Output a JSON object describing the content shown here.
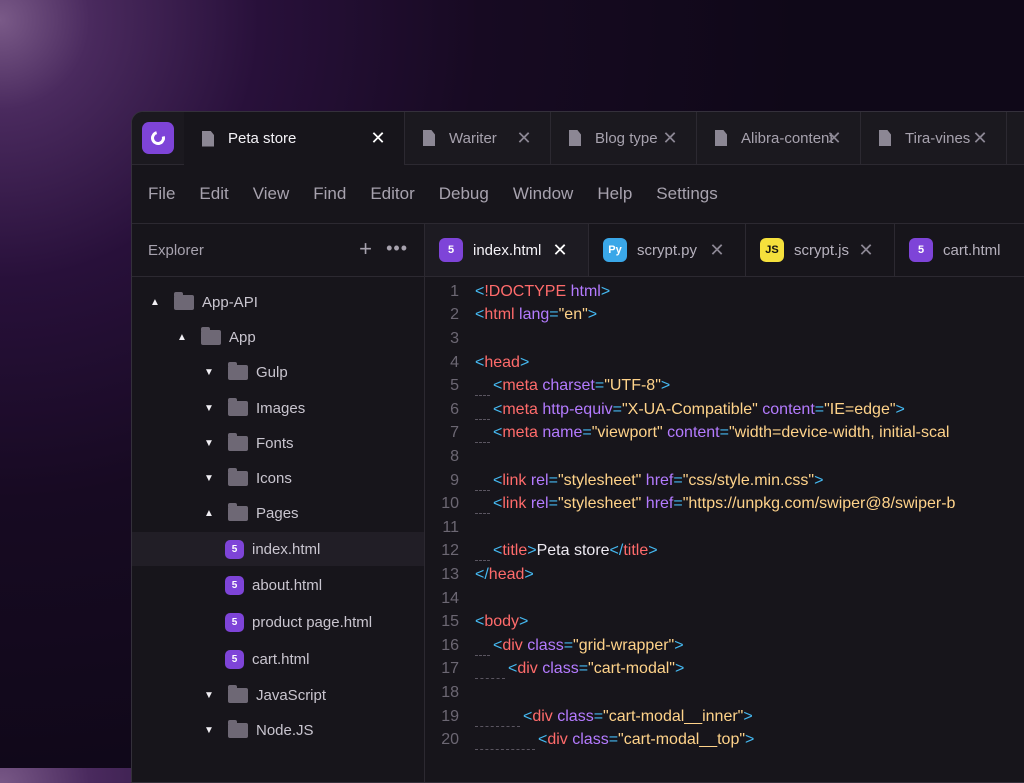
{
  "file_tabs": [
    {
      "label": "Peta store",
      "active": true
    },
    {
      "label": "Wariter",
      "active": false
    },
    {
      "label": "Blog type",
      "active": false
    },
    {
      "label": "Alibra-content",
      "active": false
    },
    {
      "label": "Tira-vines",
      "active": false
    }
  ],
  "menu": [
    "File",
    "Edit",
    "View",
    "Find",
    "Editor",
    "Debug",
    "Window",
    "Help",
    "Settings"
  ],
  "explorer": {
    "title": "Explorer",
    "tree": [
      {
        "label": "App-API",
        "type": "folder",
        "expanded": true,
        "depth": 0
      },
      {
        "label": "App",
        "type": "folder",
        "expanded": true,
        "depth": 1
      },
      {
        "label": "Gulp",
        "type": "folder",
        "expanded": false,
        "depth": 2
      },
      {
        "label": "Images",
        "type": "folder",
        "expanded": false,
        "depth": 2
      },
      {
        "label": "Fonts",
        "type": "folder",
        "expanded": false,
        "depth": 2
      },
      {
        "label": "Icons",
        "type": "folder",
        "expanded": false,
        "depth": 2
      },
      {
        "label": "Pages",
        "type": "folder",
        "expanded": true,
        "depth": 2
      },
      {
        "label": "index.html",
        "type": "file",
        "selected": true,
        "depth": 3
      },
      {
        "label": "about.html",
        "type": "file",
        "depth": 3
      },
      {
        "label": "product page.html",
        "type": "file",
        "depth": 3
      },
      {
        "label": "cart.html",
        "type": "file",
        "depth": 3
      },
      {
        "label": "JavaScript",
        "type": "folder",
        "expanded": false,
        "depth": 2
      },
      {
        "label": "Node.JS",
        "type": "folder",
        "expanded": false,
        "depth": 2
      }
    ]
  },
  "editor_tabs": [
    {
      "label": "index.html",
      "icon": "html5-icon",
      "active": true
    },
    {
      "label": "scrypt.py",
      "icon": "python-icon",
      "active": false
    },
    {
      "label": "scrypt.js",
      "icon": "js-icon",
      "active": false
    },
    {
      "label": "cart.html",
      "icon": "html5-icon",
      "active": false
    }
  ],
  "icon_glyphs": {
    "html5": "5",
    "js": "JS",
    "python": "Py"
  },
  "colors": {
    "accent": "#7e44d8",
    "python": "#3aa7e8",
    "js": "#f5e03c",
    "tag": "#ff6b6b",
    "attr": "#b47bff",
    "string": "#ffd38a",
    "punct": "#45b8f0"
  },
  "code_lines": [
    {
      "n": "1",
      "t": "<!DOCTYPE html>"
    },
    {
      "n": "2",
      "t": "<html lang=\"en\">"
    },
    {
      "n": "3",
      "t": ""
    },
    {
      "n": "4",
      "t": "<head>"
    },
    {
      "n": "5",
      "t": "  <meta charset=\"UTF-8\">"
    },
    {
      "n": "6",
      "t": "  <meta http-equiv=\"X-UA-Compatible\" content=\"IE=edge\">"
    },
    {
      "n": "7",
      "t": "  <meta name=\"viewport\" content=\"width=device-width, initial-scal"
    },
    {
      "n": "8",
      "t": ""
    },
    {
      "n": "9",
      "t": "  <link rel=\"stylesheet\" href=\"css/style.min.css\">"
    },
    {
      "n": "10",
      "t": "  <link rel=\"stylesheet\" href=\"https://unpkg.com/swiper@8/swiper-b"
    },
    {
      "n": "11",
      "t": ""
    },
    {
      "n": "12",
      "t": "  <title>Peta store</title>"
    },
    {
      "n": "13",
      "t": "</head>"
    },
    {
      "n": "14",
      "t": ""
    },
    {
      "n": "15",
      "t": "<body>"
    },
    {
      "n": "16",
      "t": "  <div class=\"grid-wrapper\">"
    },
    {
      "n": "17",
      "t": "    <div class=\"cart-modal\">"
    },
    {
      "n": "18",
      "t": ""
    },
    {
      "n": "19",
      "t": "      <div class=\"cart-modal__inner\">"
    },
    {
      "n": "20",
      "t": "        <div class=\"cart-modal__top\">"
    }
  ]
}
